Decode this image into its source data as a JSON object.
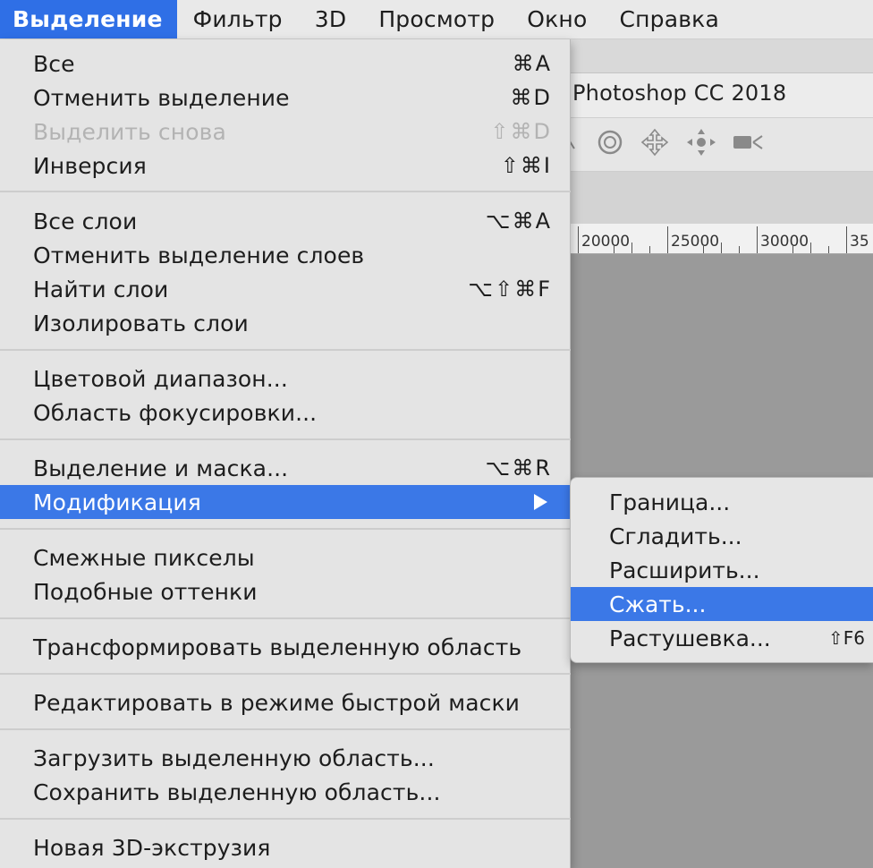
{
  "menubar": {
    "items": [
      {
        "label": "Выделение",
        "active": true
      },
      {
        "label": "Фильтр"
      },
      {
        "label": "3D"
      },
      {
        "label": "Просмотр"
      },
      {
        "label": "Окно"
      },
      {
        "label": "Справка"
      }
    ]
  },
  "window": {
    "title": "Photoshop CC 2018",
    "ruler": [
      "20000",
      "25000",
      "30000",
      "35"
    ]
  },
  "dropdown": {
    "items": [
      {
        "label": "Все",
        "shortcut": "⌘A"
      },
      {
        "label": "Отменить выделение",
        "shortcut": "⌘D"
      },
      {
        "label": "Выделить снова",
        "shortcut": "⇧⌘D",
        "disabled": true
      },
      {
        "label": "Инверсия",
        "shortcut": "⇧⌘I"
      },
      {
        "label": "Все слои",
        "shortcut": "⌥⌘A"
      },
      {
        "label": "Отменить выделение слоев",
        "shortcut": ""
      },
      {
        "label": "Найти слои",
        "shortcut": "⌥⇧⌘F"
      },
      {
        "label": "Изолировать слои",
        "shortcut": ""
      },
      {
        "label": "Цветовой диапазон...",
        "shortcut": ""
      },
      {
        "label": "Область фокусировки...",
        "shortcut": ""
      },
      {
        "label": "Выделение и маска...",
        "shortcut": "⌥⌘R"
      },
      {
        "label": "Модификация",
        "shortcut": "",
        "submenu": true,
        "highlighted": true
      },
      {
        "label": "Смежные пикселы",
        "shortcut": ""
      },
      {
        "label": "Подобные оттенки",
        "shortcut": ""
      },
      {
        "label": "Трансформировать выделенную область",
        "shortcut": ""
      },
      {
        "label": "Редактировать в режиме быстрой маски",
        "shortcut": ""
      },
      {
        "label": "Загрузить выделенную область...",
        "shortcut": ""
      },
      {
        "label": "Сохранить выделенную область...",
        "shortcut": ""
      },
      {
        "label": "Новая 3D-экструзия",
        "shortcut": ""
      }
    ]
  },
  "submenu": {
    "items": [
      {
        "label": "Граница...",
        "shortcut": ""
      },
      {
        "label": "Сгладить...",
        "shortcut": ""
      },
      {
        "label": "Расширить...",
        "shortcut": ""
      },
      {
        "label": "Сжать...",
        "shortcut": "",
        "highlighted": true
      },
      {
        "label": "Растушевка...",
        "shortcut": "⇧F6"
      }
    ]
  },
  "colors": {
    "highlight": "#3b78e7",
    "menubar_active": "#2f6fe6",
    "menu_bg": "#e4e4e4",
    "canvas": "#9a9a9a"
  },
  "icons": [
    "rotate-3d-icon",
    "pan-3d-icon",
    "slide-3d-icon",
    "camera-3d-icon"
  ]
}
